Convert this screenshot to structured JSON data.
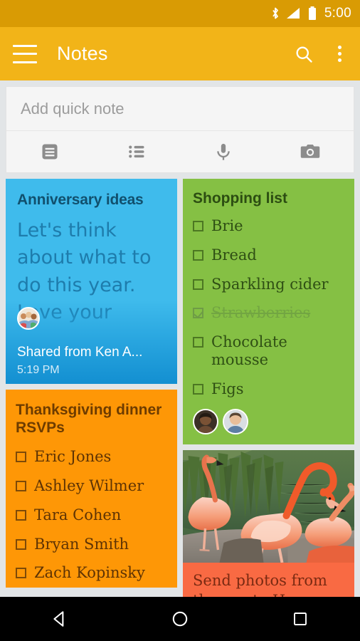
{
  "statusbar": {
    "time": "5:00",
    "icons": [
      "bluetooth-icon",
      "signal-icon",
      "battery-icon"
    ]
  },
  "appbar": {
    "title": "Notes",
    "menu_icon": "hamburger-menu-icon",
    "search_icon": "search-icon",
    "overflow_icon": "overflow-menu-icon",
    "background_color": "#F2B418"
  },
  "quick_note": {
    "placeholder": "Add quick note",
    "tools": [
      {
        "name": "text-note-icon",
        "label": "Text note"
      },
      {
        "name": "checklist-icon",
        "label": "Checklist"
      },
      {
        "name": "microphone-icon",
        "label": "Voice note"
      },
      {
        "name": "camera-icon",
        "label": "Photo note"
      }
    ]
  },
  "notes": [
    {
      "id": "anniversary-ideas",
      "type": "text",
      "title": "Anniversary ideas",
      "body": "Let's think about what to do this year. Love your",
      "color": "#3FBBEC",
      "shared_from": "Shared from Ken A...",
      "time": "5:19 PM",
      "avatar": "group-avatar"
    },
    {
      "id": "shopping-list",
      "type": "checklist",
      "title": "Shopping list",
      "color": "#85C044",
      "items": [
        {
          "label": "Brie",
          "checked": false
        },
        {
          "label": "Bread",
          "checked": false
        },
        {
          "label": "Sparkling cider",
          "checked": false
        },
        {
          "label": "Strawberries",
          "checked": true
        },
        {
          "label": "Chocolate mousse",
          "checked": false
        },
        {
          "label": "Figs",
          "checked": false
        }
      ],
      "collaborators": [
        "avatar-person-1",
        "avatar-person-2"
      ]
    },
    {
      "id": "thanksgiving-rsvps",
      "type": "checklist",
      "title": "Thanksgiving dinner RSVPs",
      "color": "#FE9706",
      "items": [
        {
          "label": "Eric Jones",
          "checked": false
        },
        {
          "label": "Ashley Wilmer",
          "checked": false
        },
        {
          "label": "Tara Cohen",
          "checked": false
        },
        {
          "label": "Bryan Smith",
          "checked": false
        },
        {
          "label": "Zach Kopinsky",
          "checked": false
        }
      ]
    },
    {
      "id": "zoo-photos",
      "type": "photo",
      "caption": "Send photos from the zoo to Harry",
      "color": "#F96A43",
      "image": "flamingos-photo"
    }
  ],
  "navbar": {
    "back_icon": "back-triangle-icon",
    "home_icon": "home-circle-icon",
    "recents_icon": "recents-square-icon"
  }
}
